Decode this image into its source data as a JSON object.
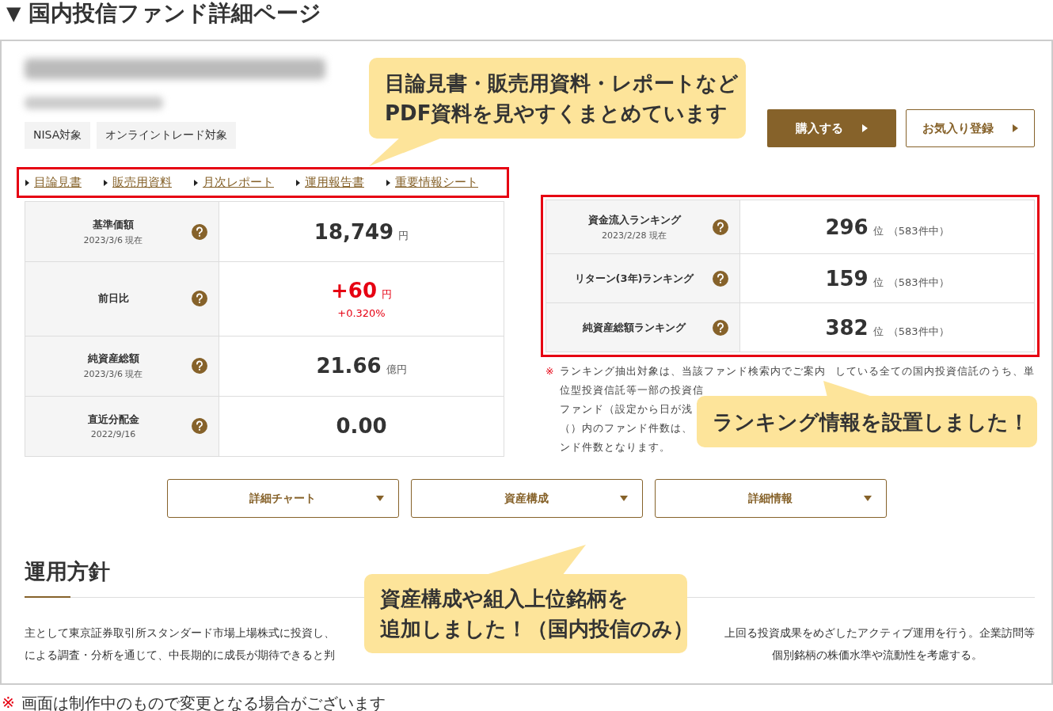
{
  "heading": {
    "marker": "▼",
    "text": "国内投信ファンド詳細ページ"
  },
  "tags": [
    "NISA対象",
    "オンライントレード対象"
  ],
  "doc_links": [
    "目論見書",
    "販売用資料",
    "月次レポート",
    "運用報告書",
    "重要情報シート"
  ],
  "actions": [
    {
      "label": "購入する",
      "kind": "primary"
    },
    {
      "label": "お気入り登録",
      "kind": "secondary"
    }
  ],
  "metrics": [
    {
      "label": "基準価額",
      "date": "2023/3/6 現在",
      "value": "18,749",
      "unit": "円",
      "kind": "plain"
    },
    {
      "label": "前日比",
      "value": "+60",
      "unit": "円",
      "sub": "+0.320%",
      "kind": "change"
    },
    {
      "label": "純資産総額",
      "date": "2023/3/6 現在",
      "value": "21.66",
      "unit": "億円",
      "kind": "plain"
    },
    {
      "label": "直近分配金",
      "date": "2022/9/16",
      "value": "0.00",
      "kind": "plain"
    }
  ],
  "rankings": [
    {
      "label": "資金流入ランキング",
      "date": "2023/2/28 現在",
      "rank": "296",
      "unit": "位",
      "total": "（583件中）"
    },
    {
      "label": "リターン(3年)ランキング",
      "rank": "159",
      "unit": "位",
      "total": "（583件中）"
    },
    {
      "label": "純資産総額ランキング",
      "rank": "382",
      "unit": "位",
      "total": "（583件中）"
    }
  ],
  "ranking_note": {
    "mark": "※",
    "lines": [
      [
        "ランキング抽出対象は、当該ファンド検索内でご案内",
        "している全ての国内投資信託のうち、単"
      ],
      [
        "位型投資信託等一部の投資信"
      ],
      [
        "ファンド（設定から日が浅"
      ],
      [
        "（）内のファンド件数は、"
      ],
      [
        "ンド件数となります。"
      ]
    ]
  },
  "toggles": [
    "詳細チャート",
    "資産構成",
    "詳細情報"
  ],
  "policy": {
    "title": "運用方針",
    "lines": [
      [
        "主として東京証券取引所スタンダード市場上場株式に投資し、",
        "上回る投資成果をめざしたアクティブ運用を行う。企業訪問等"
      ],
      [
        "による調査・分析を通じて、中長期的に成長が期待できると判",
        "個別銘柄の株価水準や流動性を考慮する。"
      ]
    ]
  },
  "callouts": [
    {
      "lines": [
        "目論見書・販売用資料・レポートなど",
        "PDF資料を見やすくまとめています"
      ]
    },
    {
      "lines": [
        "ランキング情報を設置しました！"
      ]
    },
    {
      "lines": [
        "資産構成や組入上位銘柄を",
        "追加しました！（国内投信のみ）"
      ]
    }
  ],
  "footnote": {
    "mark": "※",
    "text": "画面は制作中のもので変更となる場合がございます"
  }
}
